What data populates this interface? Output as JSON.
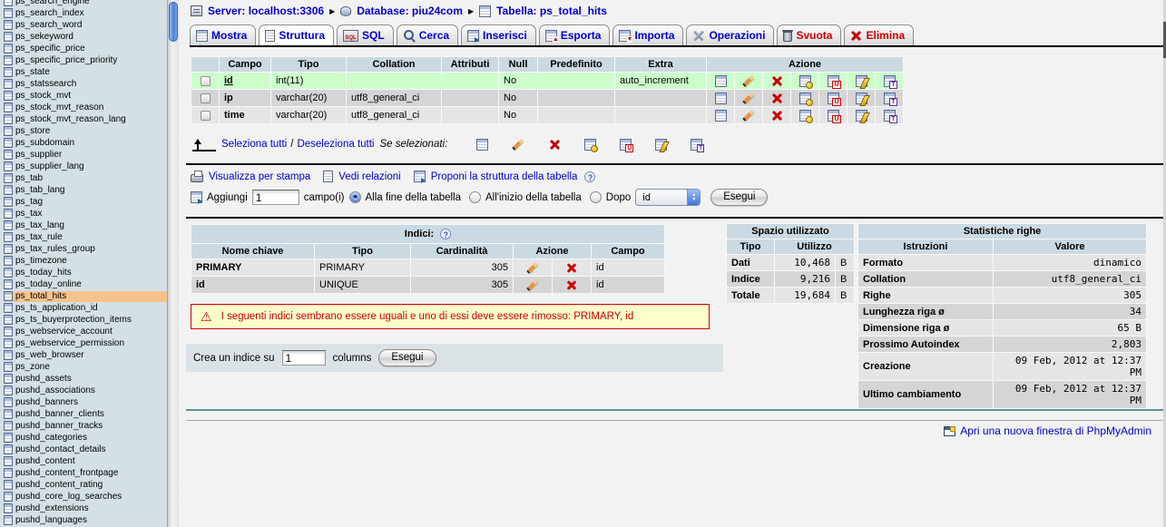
{
  "colors": {
    "page_bg": "#f2f2f2",
    "sidebar_bg": "#d4e0e6",
    "marked_item": "#f6c28c",
    "table_header": "#cbd9e2",
    "primary_row_green": "#ccffcc",
    "row_light": "#e5e5e5",
    "row_dark": "#d5d5d5",
    "link_blue": "#0000cc",
    "alert_red": "#cc0000",
    "warning_bg": "#ffffcc",
    "teal_rule": "#5e9494"
  },
  "sidebar": {
    "items": [
      {
        "label": "ps_search_engine"
      },
      {
        "label": "ps_search_index"
      },
      {
        "label": "ps_search_word"
      },
      {
        "label": "ps_sekeyword"
      },
      {
        "label": "ps_specific_price"
      },
      {
        "label": "ps_specific_price_priority"
      },
      {
        "label": "ps_state"
      },
      {
        "label": "ps_statssearch"
      },
      {
        "label": "ps_stock_mvt"
      },
      {
        "label": "ps_stock_mvt_reason"
      },
      {
        "label": "ps_stock_mvt_reason_lang"
      },
      {
        "label": "ps_store"
      },
      {
        "label": "ps_subdomain"
      },
      {
        "label": "ps_supplier"
      },
      {
        "label": "ps_supplier_lang"
      },
      {
        "label": "ps_tab"
      },
      {
        "label": "ps_tab_lang"
      },
      {
        "label": "ps_tag"
      },
      {
        "label": "ps_tax"
      },
      {
        "label": "ps_tax_lang"
      },
      {
        "label": "ps_tax_rule"
      },
      {
        "label": "ps_tax_rules_group"
      },
      {
        "label": "ps_timezone"
      },
      {
        "label": "ps_today_hits"
      },
      {
        "label": "ps_today_online"
      },
      {
        "label": "ps_total_hits",
        "highlighted": true
      },
      {
        "label": "ps_ts_application_id"
      },
      {
        "label": "ps_ts_buyerprotection_items"
      },
      {
        "label": "ps_webservice_account"
      },
      {
        "label": "ps_webservice_permission"
      },
      {
        "label": "ps_web_browser"
      },
      {
        "label": "ps_zone"
      },
      {
        "label": "pushd_assets"
      },
      {
        "label": "pushd_associations"
      },
      {
        "label": "pushd_banners"
      },
      {
        "label": "pushd_banner_clients"
      },
      {
        "label": "pushd_banner_tracks"
      },
      {
        "label": "pushd_categories"
      },
      {
        "label": "pushd_contact_details"
      },
      {
        "label": "pushd_content"
      },
      {
        "label": "pushd_content_frontpage"
      },
      {
        "label": "pushd_content_rating"
      },
      {
        "label": "pushd_core_log_searches"
      },
      {
        "label": "pushd_extensions"
      },
      {
        "label": "pushd_languages"
      }
    ]
  },
  "breadcrumb": {
    "server": {
      "label": "Server: localhost:3306",
      "icon": "server-icon"
    },
    "database": {
      "label": "Database: piu24com",
      "icon": "database-icon"
    },
    "table": {
      "label": "Tabella: ps_total_hits",
      "icon": "table-icon"
    }
  },
  "tabs": [
    {
      "label": "Mostra",
      "icon": "browse-icon",
      "style": "blue",
      "active": false
    },
    {
      "label": "Struttura",
      "icon": "structure-icon",
      "style": "blue",
      "active": true
    },
    {
      "label": "SQL",
      "icon": "sql-icon",
      "style": "blue",
      "active": false
    },
    {
      "label": "Cerca",
      "icon": "search-icon",
      "style": "blue",
      "active": false
    },
    {
      "label": "Inserisci",
      "icon": "insert-icon",
      "style": "blue",
      "active": false
    },
    {
      "label": "Esporta",
      "icon": "export-icon",
      "style": "blue",
      "active": false
    },
    {
      "label": "Importa",
      "icon": "import-icon",
      "style": "blue",
      "active": false
    },
    {
      "label": "Operazioni",
      "icon": "operations-icon",
      "style": "blue",
      "active": false
    },
    {
      "label": "Svuota",
      "icon": "empty-icon",
      "style": "red",
      "active": false
    },
    {
      "label": "Elimina",
      "icon": "drop-icon",
      "style": "red",
      "active": false
    }
  ],
  "structure_table": {
    "headers": [
      "",
      "Campo",
      "Tipo",
      "Collation",
      "Attributi",
      "Null",
      "Predefinito",
      "Extra",
      "Azione"
    ],
    "action_icons": [
      "browse-icon",
      "change-icon",
      "drop-icon",
      "primary-icon",
      "unique-icon",
      "index-icon",
      "fulltext-icon"
    ],
    "rows": [
      {
        "campo": "id",
        "tipo": "int(11)",
        "collation": "",
        "attributi": "",
        "null": "No",
        "predefinito": "",
        "extra": "auto_increment",
        "is_key": true
      },
      {
        "campo": "ip",
        "tipo": "varchar(20)",
        "collation": "utf8_general_ci",
        "attributi": "",
        "null": "No",
        "predefinito": "",
        "extra": "",
        "is_key": false
      },
      {
        "campo": "time",
        "tipo": "varchar(20)",
        "collation": "utf8_general_ci",
        "attributi": "",
        "null": "No",
        "predefinito": "",
        "extra": "",
        "is_key": false
      }
    ]
  },
  "check_all": {
    "select_all": "Seleziona tutti",
    "separator": "/",
    "deselect_all": "Deseleziona tutti",
    "if_selected": "Se selezionati:"
  },
  "links_row": {
    "print": "Visualizza per stampa",
    "relations": "Vedi relazioni",
    "propose": "Proponi la struttura della tabella"
  },
  "add_field": {
    "icon": "insert-row-icon",
    "label": "Aggiungi",
    "value": "1",
    "fields_label": "campo(i)",
    "opt_end": "Alla fine della tabella",
    "opt_begin": "All'inizio della tabella",
    "opt_after": "Dopo",
    "select_value": "id",
    "submit": "Esegui"
  },
  "indexes": {
    "title": "Indici:",
    "headers": [
      "Nome chiave",
      "Tipo",
      "Cardinalità",
      "Azione",
      "Campo"
    ],
    "rows": [
      {
        "name": "PRIMARY",
        "type": "PRIMARY",
        "cardinality": "305",
        "field": "id"
      },
      {
        "name": "id",
        "type": "UNIQUE",
        "cardinality": "305",
        "field": "id"
      }
    ]
  },
  "warning": {
    "text": "I seguenti indici sembrano essere uguali e uno di essi deve essere rimosso: PRIMARY, id"
  },
  "create_index": {
    "label": "Crea un indice su",
    "value": "1",
    "columns_label": "columns",
    "submit": "Esegui"
  },
  "space_usage": {
    "title": "Spazio utilizzato",
    "headers": [
      "Tipo",
      "Utilizzo"
    ],
    "rows": [
      {
        "label": "Dati",
        "value": "10,468",
        "unit": "B"
      },
      {
        "label": "Indice",
        "value": "9,216",
        "unit": "B"
      },
      {
        "label": "Totale",
        "value": "19,684",
        "unit": "B"
      }
    ]
  },
  "row_stats": {
    "title": "Statistiche righe",
    "headers": [
      "Istruzioni",
      "Valore"
    ],
    "rows": [
      {
        "label": "Formato",
        "value": "dinamico"
      },
      {
        "label": "Collation",
        "value": "utf8_general_ci"
      },
      {
        "label": "Righe",
        "value": "305"
      },
      {
        "label": "Lunghezza riga ø",
        "value": "34"
      },
      {
        "label": "Dimensione riga ø",
        "value": "65 B"
      },
      {
        "label": "Prossimo Autoindex",
        "value": "2,803"
      },
      {
        "label": "Creazione",
        "value": "09 Feb, 2012 at 12:37 PM"
      },
      {
        "label": "Ultimo cambiamento",
        "value": "09 Feb, 2012 at 12:37 PM"
      }
    ]
  },
  "footer": {
    "new_window": "Apri una nuova finestra di PhpMyAdmin"
  }
}
